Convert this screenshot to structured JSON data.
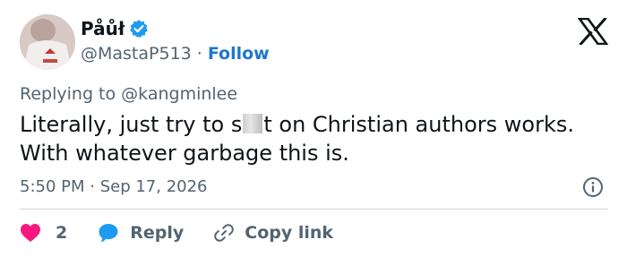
{
  "author": {
    "display_name": "Påůł",
    "handle": "@MastaP513",
    "separator": "·",
    "follow_label": "Follow"
  },
  "reply_context": "Replying to @kangminlee",
  "tweet": {
    "text_part1": "Literally, just try to s",
    "text_part2": "t on Christian authors works. With whatever garbage this is."
  },
  "meta": {
    "timestamp": "5:50 PM · Sep 17, 2026"
  },
  "actions": {
    "like_count": "2",
    "reply_label": "Reply",
    "copy_link_label": "Copy link"
  },
  "icons": {
    "verified": "verified-badge-icon",
    "logo": "x-logo-icon",
    "info": "info-icon",
    "like": "heart-icon",
    "reply": "speech-bubble-icon",
    "link": "link-icon"
  },
  "colors": {
    "accent": "#1d9bf0",
    "follow": "#1d77c9",
    "like": "#f91880",
    "text": "#0f1419",
    "muted": "#536471",
    "divider": "#cfd9de"
  }
}
